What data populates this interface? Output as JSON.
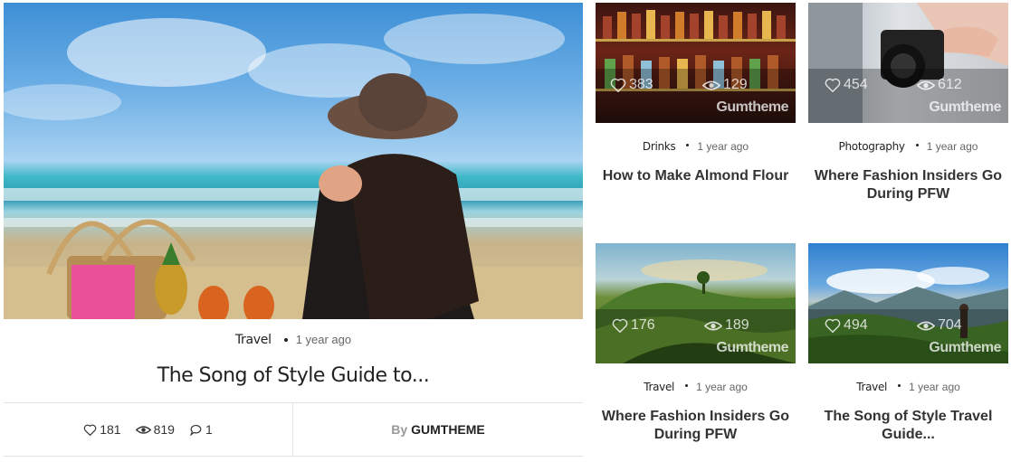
{
  "featured": {
    "category": "Travel",
    "time_ago": "1 year ago",
    "title": "The Song of Style Guide to...",
    "likes": "181",
    "views": "819",
    "comments": "1",
    "by_label": "By",
    "author": "GUMTHEME",
    "image_icon": "beach-photo"
  },
  "cards": [
    {
      "category": "Drinks",
      "time_ago": "1 year ago",
      "title": "How to Make Almond Flour",
      "likes": "383",
      "views": "129",
      "watermark": "Gumtheme",
      "image_icon": "bar-bottles-photo"
    },
    {
      "category": "Photography",
      "time_ago": "1 year ago",
      "title": "Where Fashion Insiders Go During PFW",
      "likes": "454",
      "views": "612",
      "watermark": "Gumtheme",
      "image_icon": "camera-photo"
    },
    {
      "category": "Travel",
      "time_ago": "1 year ago",
      "title": "Where Fashion Insiders Go During PFW",
      "likes": "176",
      "views": "189",
      "watermark": "Gumtheme",
      "image_icon": "green-hills-photo"
    },
    {
      "category": "Travel",
      "time_ago": "1 year ago",
      "title": "The Song of Style Travel Guide...",
      "likes": "494",
      "views": "704",
      "watermark": "Gumtheme",
      "image_icon": "mountains-photo"
    }
  ],
  "colors": {
    "text": "#222222",
    "muted": "#666666",
    "border": "#e2e2e2",
    "overlay_text": "#ffffff"
  }
}
